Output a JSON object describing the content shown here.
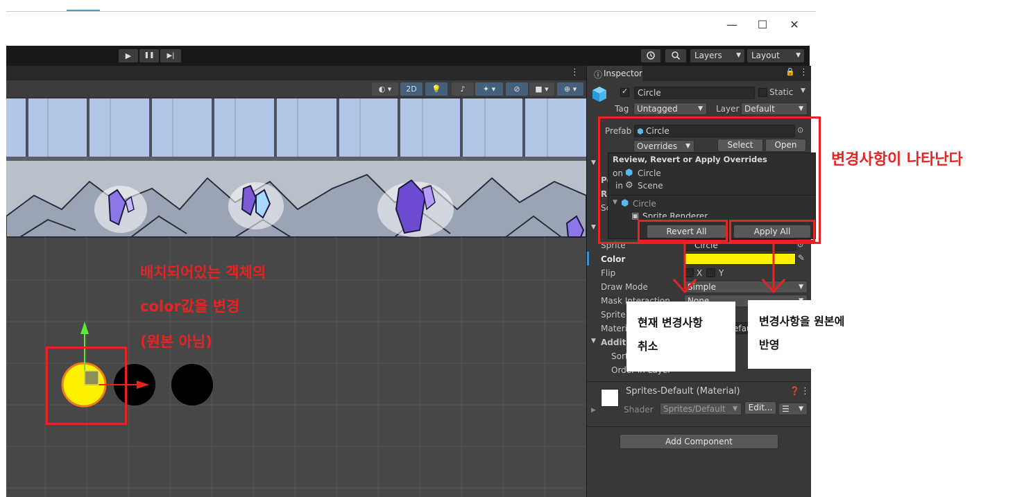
{
  "window": {
    "minimize": "—",
    "maximize": "☐",
    "close": "✕"
  },
  "toolbar": {
    "play": "▶",
    "pause": "❚❚",
    "step": "▶|",
    "history_icon": "history-icon",
    "search_icon": "search-icon",
    "layers_label": "Layers",
    "layout_label": "Layout"
  },
  "scene": {
    "menu_dots": "⋮",
    "tools": {
      "twod_label": "2D"
    }
  },
  "inspector": {
    "tab_label": "Inspector",
    "lock": "🔒",
    "menu_dots": "⋮",
    "name": "Circle",
    "static_label": "Static",
    "tag_label": "Tag",
    "tag_value": "Untagged",
    "layer_label": "Layer",
    "layer_value": "Default",
    "prefab_label": "Prefab",
    "prefab_value": "Circle",
    "overrides_label": "Overrides",
    "select_label": "Select",
    "open_label": "Open",
    "behind_labels": [
      "Po",
      "Ro",
      "Sc"
    ],
    "sprite_label": "Sprite",
    "sprite_value": "Circle",
    "color_label": "Color",
    "color_value": "#fff200",
    "flip_label": "Flip",
    "flip_x": "X",
    "flip_y": "Y",
    "draw_mode_label": "Draw Mode",
    "draw_mode_value": "Simple",
    "mask_label": "Mask Interaction",
    "mask_value": "None",
    "sprite_sort_label": "Sprite S",
    "material_label": "Materia",
    "material_value": "efau",
    "additional_label": "Additi",
    "sorting_label": "Sorti",
    "order_label": "Order in Layer",
    "material_asset": "Sprites-Default (Material)",
    "shader_label": "Shader",
    "shader_value": "Sprites/Default",
    "edit_label": "Edit...",
    "add_component": "Add Component"
  },
  "popup": {
    "title": "Review, Revert or Apply Overrides",
    "on_label": "on",
    "on_value": "Circle",
    "in_label": "in",
    "in_value": "Scene",
    "tree_root": "Circle",
    "tree_child": "Sprite Renderer",
    "revert_all": "Revert All",
    "apply_all": "Apply All"
  },
  "annotations": {
    "changes_shown": "변경사항이 나타난다",
    "scene_line1": "배치되어있는 객체의",
    "scene_line2": "color값을 변경",
    "scene_line3": "(원본 아님)",
    "revert_note_line1": "현재 변경사항",
    "revert_note_line2": "취소",
    "apply_note_line1": "변경사항을 원본에",
    "apply_note_line2": "반영",
    "color": "#e82323"
  },
  "colors": {
    "accent": "#46607c",
    "selected_yellow": "#fff200"
  }
}
